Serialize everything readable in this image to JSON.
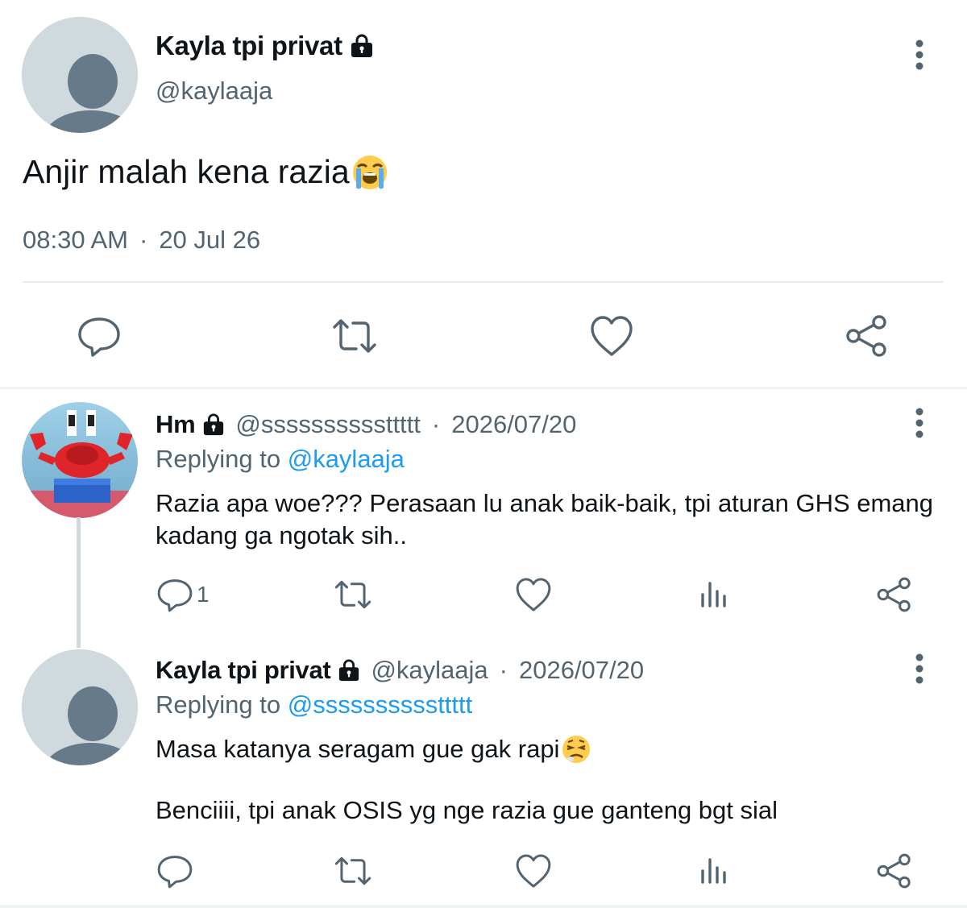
{
  "main_tweet": {
    "author_name": "Kayla tpi privat",
    "handle": "@kaylaaja",
    "text": "Anjir malah kena razia",
    "emoji": "loudly-crying-face",
    "time": "08:30 AM",
    "separator": "·",
    "date": "20 Jul 26",
    "actions": [
      "reply-icon",
      "retweet-icon",
      "like-icon",
      "share-icon"
    ]
  },
  "replies": [
    {
      "author_name": "Hm",
      "handle": "@ssssssssssttttt",
      "separator": "·",
      "date": "2026/07/20",
      "replying_prefix": "Replying to",
      "replying_to": "@kaylaaja",
      "text": "Razia apa woe??? Perasaan lu anak baik-baik, tpi aturan GHS emang kadang ga ngotak sih..",
      "reply_count": "1",
      "avatar": "crab-toy-avatar"
    },
    {
      "author_name": "Kayla tpi privat",
      "handle": "@kaylaaja",
      "separator": "·",
      "date": "2026/07/20",
      "replying_prefix": "Replying to",
      "replying_to": "@ssssssssssttttt",
      "text_line1": "Masa katanya seragam gue gak rapi",
      "emoji": "tired-face",
      "text_line2": "Benciiii, tpi anak OSIS yg nge razia gue ganteng bgt sial",
      "reply_count": "",
      "avatar": "default-avatar"
    }
  ],
  "colors": {
    "text": "#0f1419",
    "muted": "#536471",
    "link": "#1d9bf0",
    "avatar_bg": "#cfd9de",
    "avatar_fg": "#677a89"
  }
}
